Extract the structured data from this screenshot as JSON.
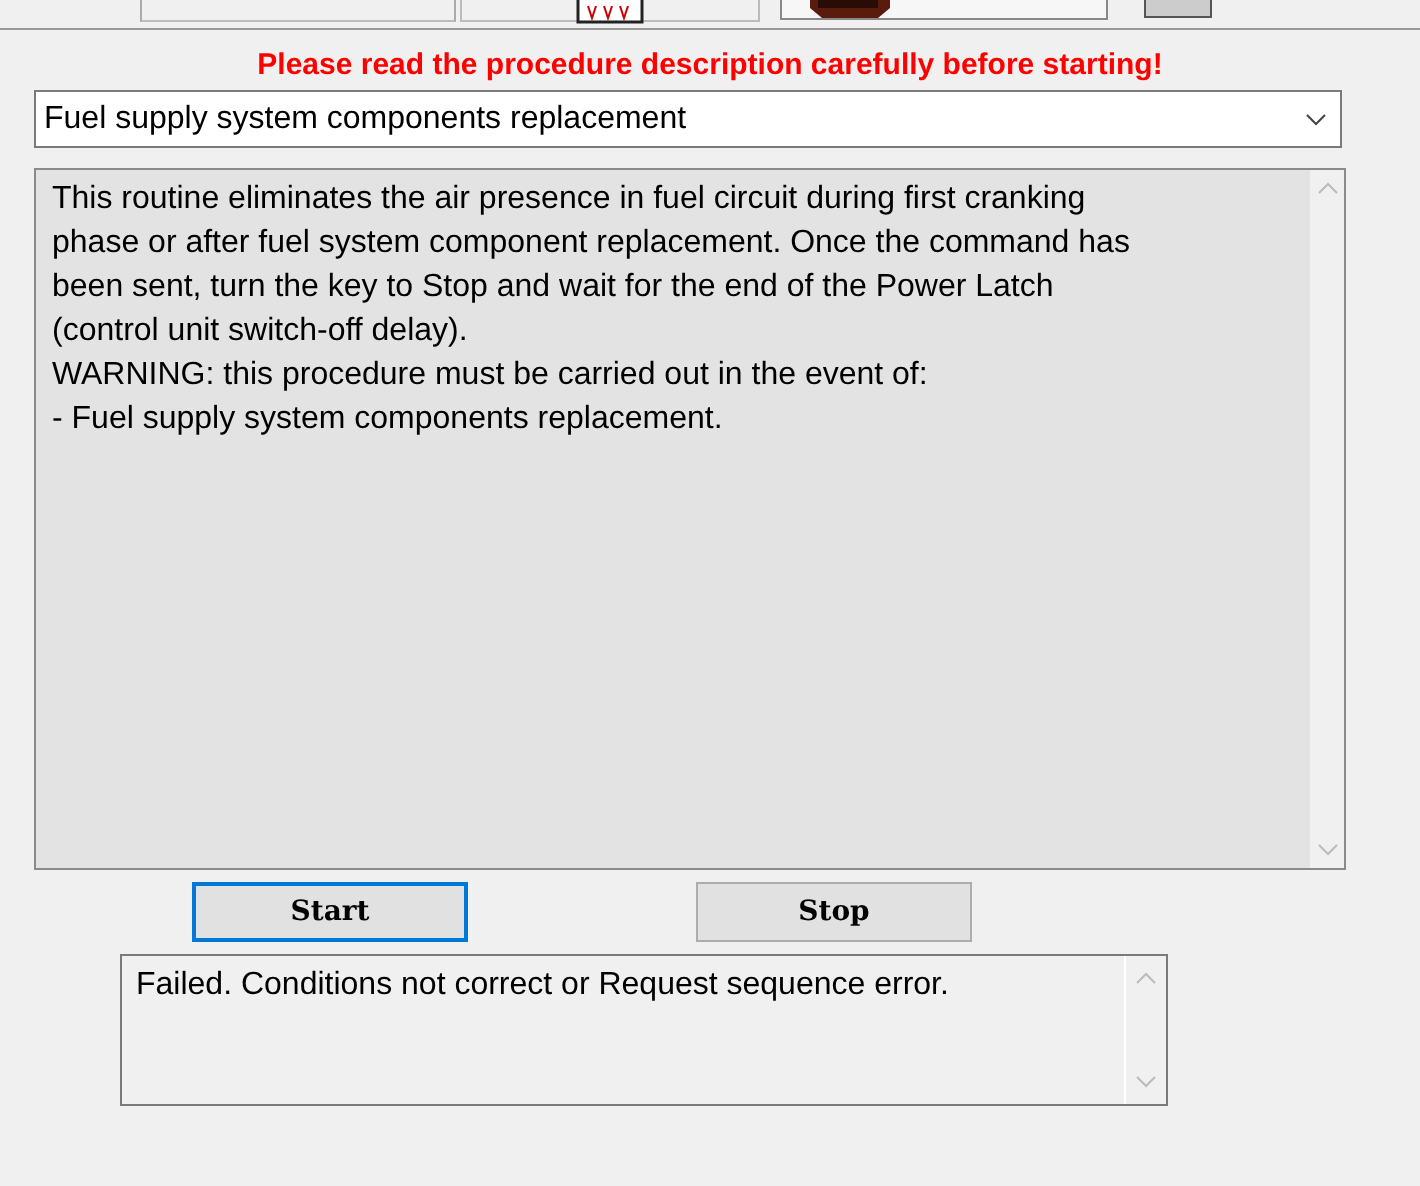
{
  "notice": "Please read the procedure description carefully before starting!",
  "procedure_select": {
    "value": "Fuel supply system components replacement"
  },
  "description": {
    "lines": [
      "This routine eliminates the air presence in fuel circuit during first cranking",
      "phase or after fuel system component replacement. Once the command has",
      "been sent, turn the key to Stop and wait for the end of the Power Latch",
      "(control unit switch-off delay).",
      "WARNING: this procedure must be carried out in the event of:",
      "- Fuel supply system components replacement."
    ]
  },
  "buttons": [
    {
      "label": "Start",
      "focused": true
    },
    {
      "label": "Stop",
      "focused": false
    }
  ],
  "result": {
    "text": "Failed. Conditions not correct or Request sequence error."
  }
}
